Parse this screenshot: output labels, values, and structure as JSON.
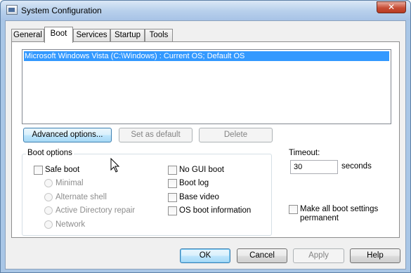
{
  "window": {
    "title": "System Configuration",
    "close_symbol": "✕"
  },
  "tabs": [
    {
      "label": "General"
    },
    {
      "label": "Boot",
      "selected": true
    },
    {
      "label": "Services"
    },
    {
      "label": "Startup"
    },
    {
      "label": "Tools"
    }
  ],
  "os_list": {
    "items": [
      "Microsoft Windows Vista (C:\\Windows) : Current OS; Default OS"
    ],
    "selected_index": 0
  },
  "list_buttons": {
    "advanced": "Advanced options...",
    "set_default": "Set as default",
    "delete": "Delete"
  },
  "boot_options": {
    "label": "Boot options",
    "safe_boot": {
      "label": "Safe boot",
      "checked": false
    },
    "radios": [
      {
        "label": "Minimal"
      },
      {
        "label": "Alternate shell"
      },
      {
        "label": "Active Directory repair"
      },
      {
        "label": "Network"
      }
    ],
    "no_gui_boot": {
      "label": "No GUI boot",
      "checked": false
    },
    "boot_log": {
      "label": "Boot log",
      "checked": false
    },
    "base_video": {
      "label": "Base video",
      "checked": false
    },
    "os_boot_info": {
      "label": "OS boot information",
      "checked": false
    }
  },
  "timeout": {
    "label": "Timeout:",
    "value": "30",
    "unit": "seconds"
  },
  "make_permanent": {
    "line1": "Make all boot settings",
    "line2": "permanent",
    "checked": false
  },
  "footer": {
    "ok": "OK",
    "cancel": "Cancel",
    "apply": "Apply",
    "help": "Help"
  },
  "colors": {
    "selection": "#3399ff",
    "title_gradient": "#b9d1ec",
    "close_button": "#c74e36"
  }
}
